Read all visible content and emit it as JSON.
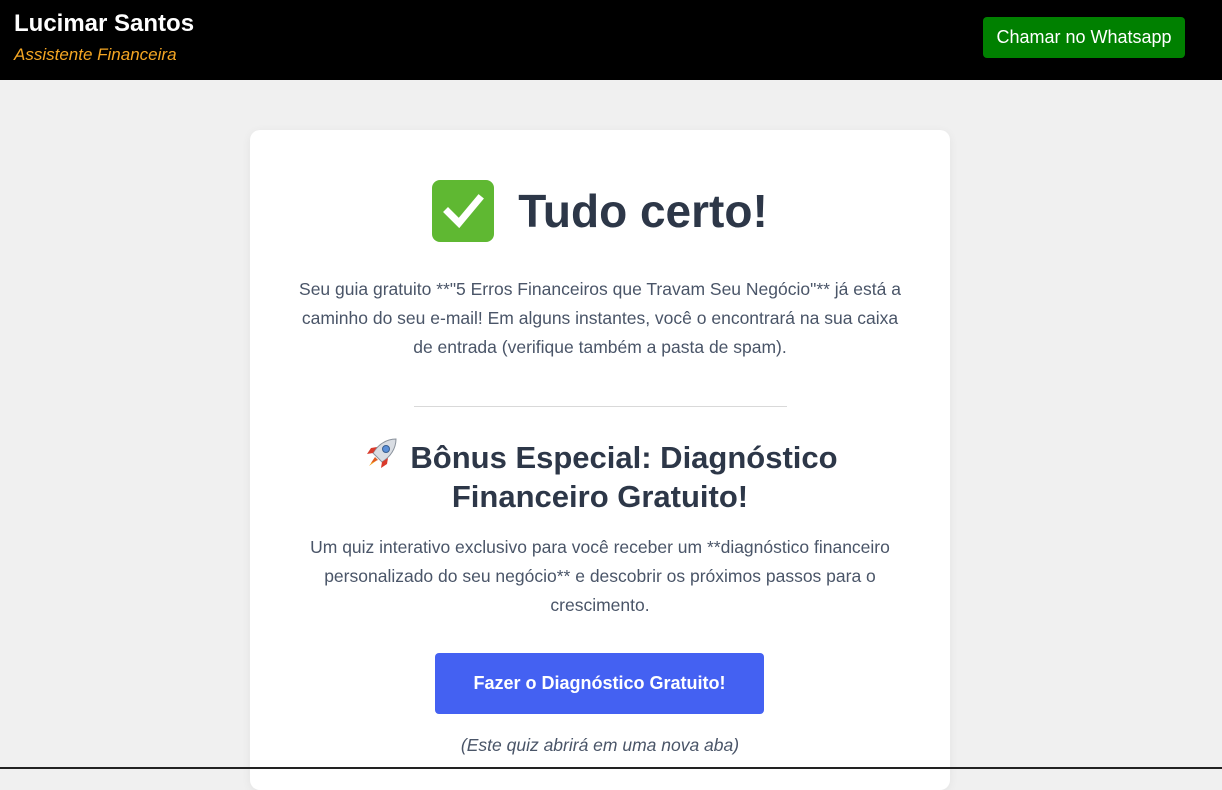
{
  "header": {
    "name": "Lucimar Santos",
    "role": "Assistente Financeira",
    "whatsapp_button": "Chamar no Whatsapp"
  },
  "card": {
    "title_icon": "check-mark-icon",
    "title": "Tudo certo!",
    "message": "Seu guia gratuito **\"5 Erros Financeiros que Travam Seu Negócio\"** já está a caminho do seu e-mail! Em alguns instantes, você o encontrará na sua caixa de entrada (verifique também a pasta de spam).",
    "bonus_icon": "rocket-icon",
    "bonus_title": "Bônus Especial: Diagnóstico Financeiro Gratuito!",
    "bonus_text": "Um quiz interativo exclusivo para você receber um **diagnóstico financeiro personalizado do seu negócio** e descobrir os próximos passos para o crescimento.",
    "cta_label": "Fazer o Diagnóstico Gratuito!",
    "cta_note": "(Este quiz abrirá em uma nova aba)"
  },
  "colors": {
    "header_bg": "#000000",
    "role_text": "#f5a623",
    "whatsapp_bg": "#008000",
    "cta_bg": "#4461f2",
    "page_bg": "#f0f0f0"
  }
}
